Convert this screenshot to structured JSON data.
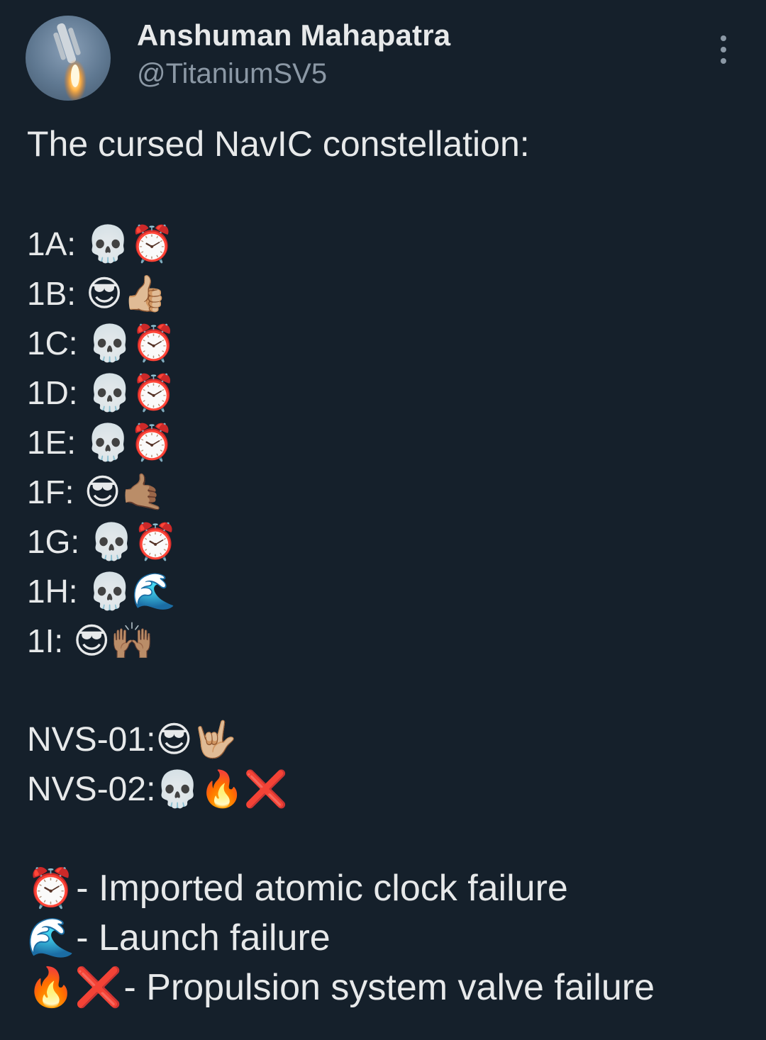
{
  "author": {
    "name": "Anshuman Mahapatra",
    "handle": "@TitaniumSV5"
  },
  "tweet": {
    "headline": "The cursed NavIC constellation:",
    "satellites": [
      {
        "label": "1A:",
        "emoji": "💀⏰"
      },
      {
        "label": "1B:",
        "emoji": "😎👍🏼"
      },
      {
        "label": "1C:",
        "emoji": "💀⏰"
      },
      {
        "label": "1D:",
        "emoji": "💀⏰"
      },
      {
        "label": "1E:",
        "emoji": "💀⏰"
      },
      {
        "label": "1F:",
        "emoji": "😎🤙🏽"
      },
      {
        "label": "1G:",
        "emoji": "💀⏰"
      },
      {
        "label": "1H:",
        "emoji": "💀🌊"
      },
      {
        "label": "1I:",
        "emoji": "😎🙌🏽"
      }
    ],
    "nvs": [
      {
        "label": "NVS-01:",
        "emoji": "😎🤟🏼"
      },
      {
        "label": "NVS-02:",
        "emoji": "💀🔥❌"
      }
    ],
    "legend": [
      {
        "emoji": "⏰",
        "text": "- Imported atomic clock failure"
      },
      {
        "emoji": "🌊",
        "text": "- Launch failure"
      },
      {
        "emoji": "🔥❌",
        "text": "- Propulsion system valve failure"
      }
    ]
  }
}
